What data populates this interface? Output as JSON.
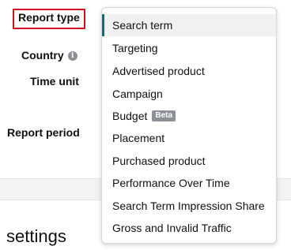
{
  "form": {
    "report_type_label": "Report type",
    "country_label": "Country",
    "country_info_icon": "info-icon",
    "time_unit_label": "Time unit",
    "report_period_label": "Report period"
  },
  "section": {
    "settings_heading": "settings"
  },
  "dropdown": {
    "selected_value": "Search term",
    "options": [
      {
        "label": "Search term",
        "selected": true
      },
      {
        "label": "Targeting"
      },
      {
        "label": "Advertised product"
      },
      {
        "label": "Campaign"
      },
      {
        "label": "Budget",
        "badge": "Beta"
      },
      {
        "label": "Placement"
      },
      {
        "label": "Purchased product"
      },
      {
        "label": "Performance Over Time"
      },
      {
        "label": "Search Term Impression Share"
      },
      {
        "label": "Gross and Invalid Traffic"
      }
    ]
  },
  "colors": {
    "highlight_border": "#d40e1e",
    "selected_accent": "#007185",
    "selected_background": "#f0f2f2",
    "badge_background": "#8d9096"
  }
}
